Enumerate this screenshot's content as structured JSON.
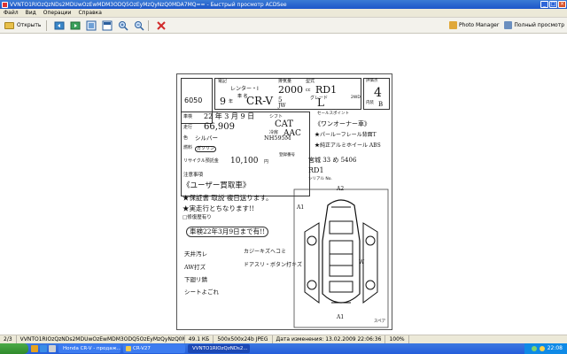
{
  "window": {
    "title": "VVNTO1RIOzQzNDs2MDUwOzEwMDM3ODQ5OzEyMzQyNzQ0MDA7MQ== - Быстрый просмотр ACDSee",
    "controls": [
      "_",
      "□",
      "×"
    ]
  },
  "menu": [
    "Файл",
    "Вид",
    "Операции",
    "Справка"
  ],
  "toolbar": {
    "open_label": "Открыть",
    "buttons": [
      "prev-image",
      "next-image",
      "fit-image",
      "full-screen",
      "zoom-in",
      "zoom-out",
      "delete"
    ],
    "photo_manager_label": "Photo Manager",
    "fullscreen_label": "Полный просмотр"
  },
  "sheet": {
    "lot": "6050",
    "header": {
      "reg_label": "電記",
      "rental_note": "レンター・I",
      "year": "9",
      "year_unit": "年",
      "model_label": "車 名",
      "model": "CR-V",
      "displacement_label": "排気量",
      "displacement": "2000",
      "cc_unit": "cc",
      "type_label": "型式",
      "type_code": "RD1",
      "grade_label": "グレード",
      "grade": "L",
      "doors": "5",
      "body": "JW",
      "drive": "2WD",
      "score_label": "評価点",
      "score": "4",
      "interior_label": "内装",
      "interior": "B"
    },
    "inspection": {
      "label": "車検",
      "value": "22 年 3 月 9 日"
    },
    "mileage": {
      "label": "走行",
      "value": "66,909"
    },
    "color": {
      "label": "色",
      "value": "シルバー",
      "code": "NH595M"
    },
    "fuel": {
      "label": "燃料",
      "value": "ガソリン"
    },
    "shift": {
      "label": "シフト",
      "value": "CAT"
    },
    "ac": {
      "label": "冷房",
      "value": "AAC"
    },
    "sales_points_label": "セールスポイント",
    "sales_points": [
      "《ワンオーナー車》",
      "★パールーフレール背面T",
      "★純正アルミホイール ABS"
    ],
    "recycle": {
      "label": "リサイクル預託金",
      "value": "10,100",
      "unit": "円"
    },
    "plate": {
      "label": "登録番号",
      "value": "宮城 33 め 5406"
    },
    "frame": {
      "value": "RD1"
    },
    "serial_label": "シリアル No.",
    "notes_label": "注意事項",
    "comments": [
      "《ユーザー買取車》",
      "★保証書 取説 複日送ります。",
      "★実走行とちなります!!",
      "□修復歴有り",
      "車検22年3月9日まで有!!"
    ],
    "diagram_labels": [
      "A2",
      "A1",
      "W",
      "A1"
    ],
    "bottom_notes": [
      "天井汚レ",
      "カジーキズヘコミ",
      "AW打ズ",
      "ドアスリ・ボタン打キズ",
      "下廻リ錆",
      "シートよごれ"
    ],
    "bottom_label": "スペア"
  },
  "status": {
    "index": "2/3",
    "filename": "VVNTO1RIOzQzNDs2MDUwOzEwMDM3ODQ5OzEyMzQyNzQ0MDA7MQ==",
    "size": "49.1 КБ",
    "dims": "500x500x24b JPEG",
    "modified": "Дата изменения: 13.02.2009 22:06:36",
    "zoom": "100%"
  },
  "taskbar": {
    "tasks": [
      "Honda CR-V - продаж...",
      "CR-V27",
      "VVNTO1RIOzQzNDs2..."
    ],
    "clock": "22:08"
  },
  "colors": {
    "title": "#245edb",
    "task_active": "#1c48b4",
    "close": "#d9532c"
  }
}
